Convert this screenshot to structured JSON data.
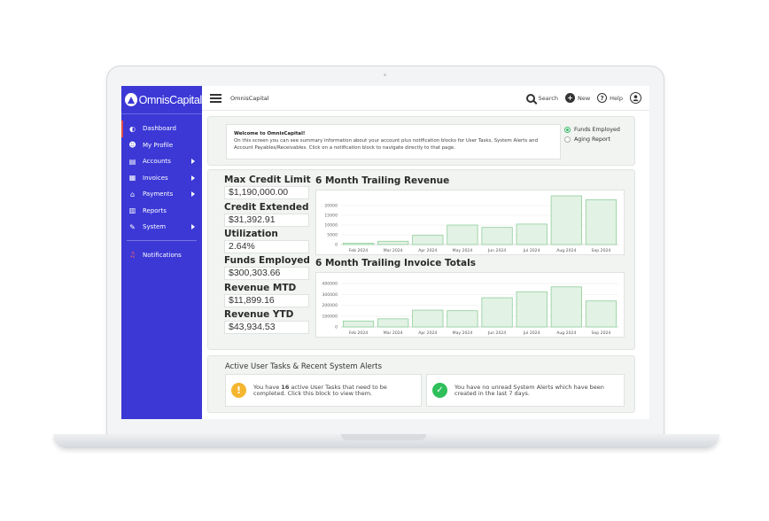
{
  "app": {
    "brand": "OmnisCapital",
    "topbar_title": "OmnisCapital"
  },
  "topbar": {
    "search_label": "Search",
    "new_label": "New",
    "help_label": "Help"
  },
  "sidebar": {
    "items": [
      {
        "label": "Dashboard",
        "icon": "dashboard-icon",
        "active": true,
        "arrow": false
      },
      {
        "label": "My Profile",
        "icon": "user-icon",
        "active": false,
        "arrow": false
      },
      {
        "label": "Accounts",
        "icon": "accounts-icon",
        "active": false,
        "arrow": true
      },
      {
        "label": "Invoices",
        "icon": "invoice-icon",
        "active": false,
        "arrow": true
      },
      {
        "label": "Payments",
        "icon": "bank-icon",
        "active": false,
        "arrow": true
      },
      {
        "label": "Reports",
        "icon": "chart-icon",
        "active": false,
        "arrow": false
      },
      {
        "label": "System",
        "icon": "wrench-icon",
        "active": false,
        "arrow": true
      }
    ],
    "notifications_label": "Notifications"
  },
  "welcome": {
    "title": "Welcome to OmnisCapital!",
    "body": "On this screen you can see summary information about your account plus notification blocks for User Tasks, System Alerts and Account Payables/Receivables.  Click on a notification block to navigate directly to that page."
  },
  "view_options": [
    {
      "label": "Funds Employed",
      "selected": true
    },
    {
      "label": "Aging Report",
      "selected": false
    }
  ],
  "stats": [
    {
      "label": "Max Credit Limit",
      "value": "$1,190,000.00"
    },
    {
      "label": "Credit Extended",
      "value": "$31,392.91"
    },
    {
      "label": "Utilization",
      "value": "2.64%"
    },
    {
      "label": "Funds Employed",
      "value": "$300,303.66"
    },
    {
      "label": "Revenue MTD",
      "value": "$11,899.16"
    },
    {
      "label": "Revenue YTD",
      "value": "$43,934.53"
    }
  ],
  "chart_data": [
    {
      "type": "bar",
      "title": "6 Month Trailing Revenue",
      "categories": [
        "Feb 2024",
        "Mar 2024",
        "Apr 2024",
        "May 2024",
        "Jun 2024",
        "Jul 2024",
        "Aug 2024",
        "Sep 2024"
      ],
      "values": [
        700,
        1700,
        4700,
        10000,
        8800,
        10500,
        25000,
        23000
      ],
      "yticks": [
        "0",
        "5000",
        "10000",
        "15000",
        "20000"
      ],
      "ylim": [
        0,
        25000
      ],
      "bar_color": "#e2f2e4",
      "bar_stroke": "#8fce9b",
      "grid": true
    },
    {
      "type": "bar",
      "title": "6 Month Trailing Invoice Totals",
      "categories": [
        "Feb 2024",
        "Mar 2024",
        "Apr 2024",
        "May 2024",
        "Jun 2024",
        "Jul 2024",
        "Aug 2024",
        "Sep 2024"
      ],
      "values": [
        55000,
        75000,
        155000,
        150000,
        270000,
        325000,
        370000,
        240000
      ],
      "yticks": [
        "0",
        "100000",
        "200000",
        "300000",
        "400000"
      ],
      "ylim": [
        0,
        450000
      ],
      "bar_color": "#e2f2e4",
      "bar_stroke": "#8fce9b",
      "grid": true
    }
  ],
  "alerts": {
    "title": "Active User Tasks & Recent System Alerts",
    "tasks_prefix": "You have ",
    "tasks_count": "16",
    "tasks_suffix": " active User Tasks that need to be completed.  Click this block to view them.",
    "system_text": "You have no unread System Alerts which have been created in the last 7 days."
  },
  "colors": {
    "sidebar": "#3b38d6",
    "accent_green": "#3cb96b",
    "warning": "#f5b62f",
    "success": "#2fbf5b"
  }
}
